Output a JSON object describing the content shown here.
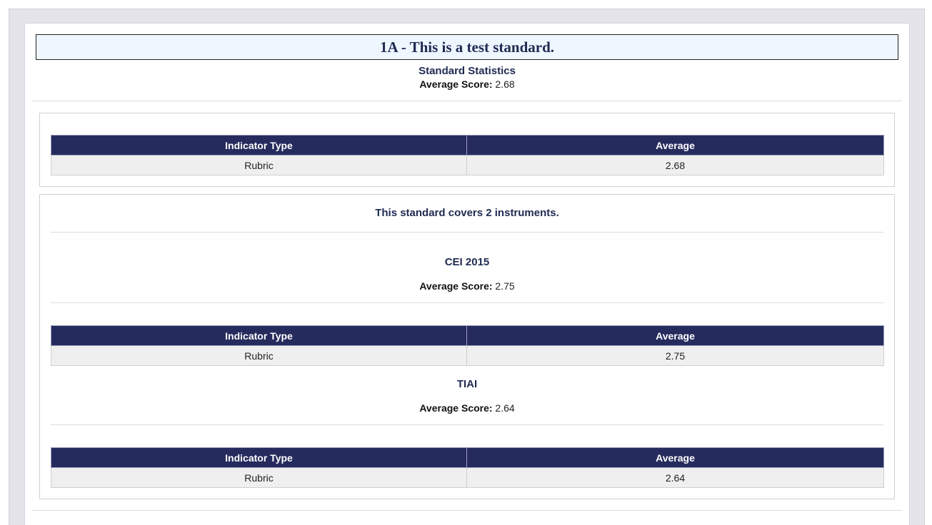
{
  "standard": {
    "title": "1A - This is a test standard.",
    "stats_heading": "Standard Statistics",
    "avg_label": "Average Score:",
    "avg_value": "2.68"
  },
  "summary_table": {
    "headers": [
      "Indicator Type",
      "Average"
    ],
    "rows": [
      [
        "Rubric",
        "2.68"
      ]
    ]
  },
  "instruments_section": {
    "heading": "This standard covers 2 instruments.",
    "instruments": [
      {
        "name": "CEI 2015",
        "avg_label": "Average Score:",
        "avg_value": "2.75",
        "table": {
          "headers": [
            "Indicator Type",
            "Average"
          ],
          "rows": [
            [
              "Rubric",
              "2.75"
            ]
          ]
        }
      },
      {
        "name": "TIAI",
        "avg_label": "Average Score:",
        "avg_value": "2.64",
        "table": {
          "headers": [
            "Indicator Type",
            "Average"
          ],
          "rows": [
            [
              "Rubric",
              "2.64"
            ]
          ]
        }
      }
    ]
  },
  "colors": {
    "header_bg": "#262b5e",
    "title_bg": "#eef6ff",
    "heading_text": "#1f2a52",
    "row_bg": "#efefef"
  }
}
